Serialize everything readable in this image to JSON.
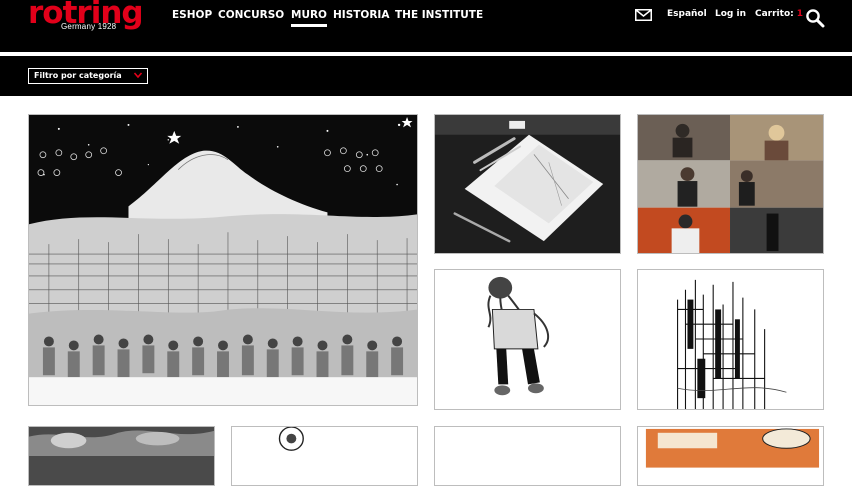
{
  "header": {
    "logo_text": "rotring",
    "logo_subtitle": "Germany 1928",
    "nav": [
      {
        "label": "ESHOP",
        "active": false
      },
      {
        "label": "CONCURSO",
        "active": false
      },
      {
        "label": "MURO",
        "active": true
      },
      {
        "label": "HISTORIA",
        "active": false
      },
      {
        "label": "THE INSTITUTE",
        "active": false
      }
    ],
    "mail_icon": "mail-icon",
    "language_label": "Español",
    "login_label": "Log in",
    "cart_label": "Carrito:",
    "cart_count": "1",
    "search_icon": "search-icon"
  },
  "filter": {
    "label": "Filtro por categoría",
    "icon": "chevron-down-icon"
  },
  "colors": {
    "brand_red": "#e2001a",
    "bar_black": "#000000",
    "tile_border": "#bdbdbd"
  },
  "gallery": {
    "tiles": [
      {
        "name": "gallery-tile-mountain-village-illustration",
        "icon": "artwork-image"
      },
      {
        "name": "gallery-tile-notebook-pens-photo",
        "icon": "product-photo"
      },
      {
        "name": "gallery-tile-artists-collage-photo",
        "icon": "photo-collage"
      },
      {
        "name": "gallery-tile-octopus-figure-drawing",
        "icon": "artwork-image"
      },
      {
        "name": "gallery-tile-ink-buildings-sketch",
        "icon": "artwork-image"
      },
      {
        "name": "gallery-tile-bottom-1",
        "icon": "artwork-image"
      },
      {
        "name": "gallery-tile-bottom-2",
        "icon": "artwork-image"
      },
      {
        "name": "gallery-tile-bottom-3",
        "icon": "artwork-image"
      },
      {
        "name": "gallery-tile-bottom-4-sunday-poster",
        "icon": "artwork-image"
      }
    ]
  }
}
